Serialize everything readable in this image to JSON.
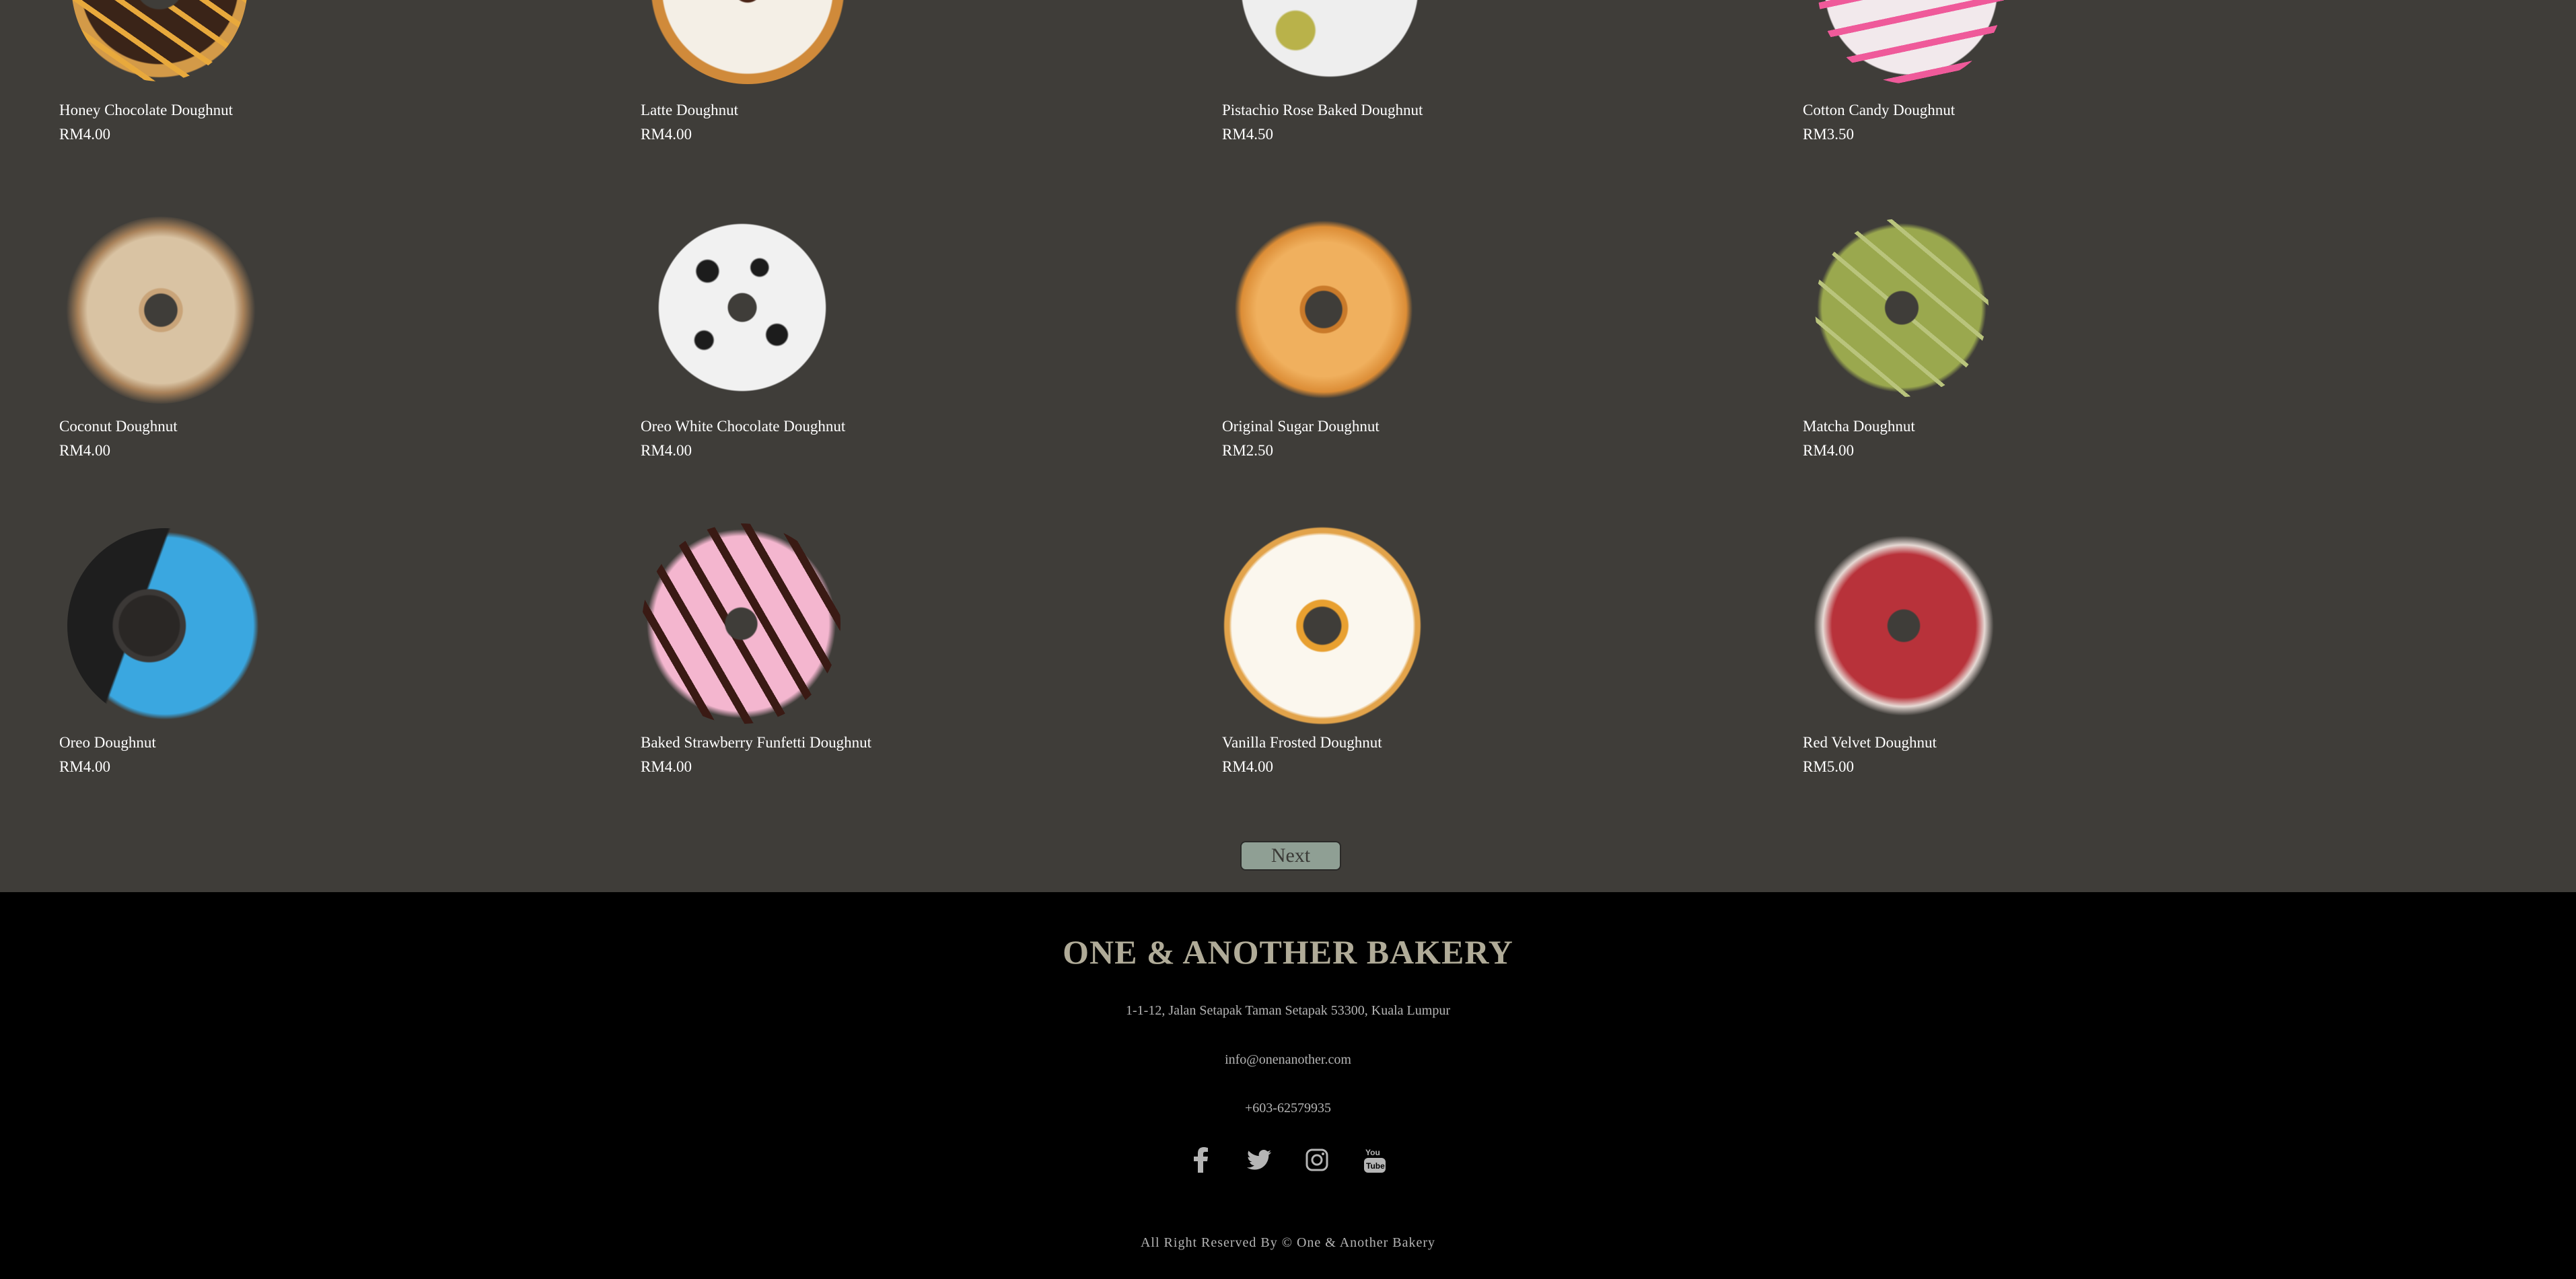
{
  "products": [
    {
      "name": "Honey Chocolate Doughnut",
      "price": "RM4.00"
    },
    {
      "name": "Latte Doughnut",
      "price": "RM4.00"
    },
    {
      "name": "Pistachio Rose Baked Doughnut",
      "price": "RM4.50"
    },
    {
      "name": "Cotton Candy Doughnut",
      "price": "RM3.50"
    },
    {
      "name": "Coconut Doughnut",
      "price": "RM4.00"
    },
    {
      "name": "Oreo White Chocolate Doughnut",
      "price": "RM4.00"
    },
    {
      "name": "Original Sugar Doughnut",
      "price": "RM2.50"
    },
    {
      "name": "Matcha Doughnut",
      "price": "RM4.00"
    },
    {
      "name": "Oreo Doughnut",
      "price": "RM4.00"
    },
    {
      "name": "Baked Strawberry Funfetti Doughnut",
      "price": "RM4.00"
    },
    {
      "name": "Vanilla Frosted Doughnut",
      "price": "RM4.00"
    },
    {
      "name": "Red Velvet Doughnut",
      "price": "RM5.00"
    }
  ],
  "pagination": {
    "next_label": "Next"
  },
  "footer": {
    "brand": "ONE & ANOTHER BAKERY",
    "address": "1-1-12, Jalan Setapak Taman Setapak 53300, Kuala Lumpur",
    "email": "info@onenanother.com",
    "phone": "+603-62579935",
    "social_icons": [
      "facebook-icon",
      "twitter-icon",
      "instagram-icon",
      "youtube-icon"
    ],
    "copyright": "All Right Reserved By © One & Another Bakery"
  },
  "colors": {
    "page_bg": "#3f3d39",
    "footer_bg": "#000000",
    "brand": "#b0ab98",
    "next_button": "#8f9f94"
  }
}
